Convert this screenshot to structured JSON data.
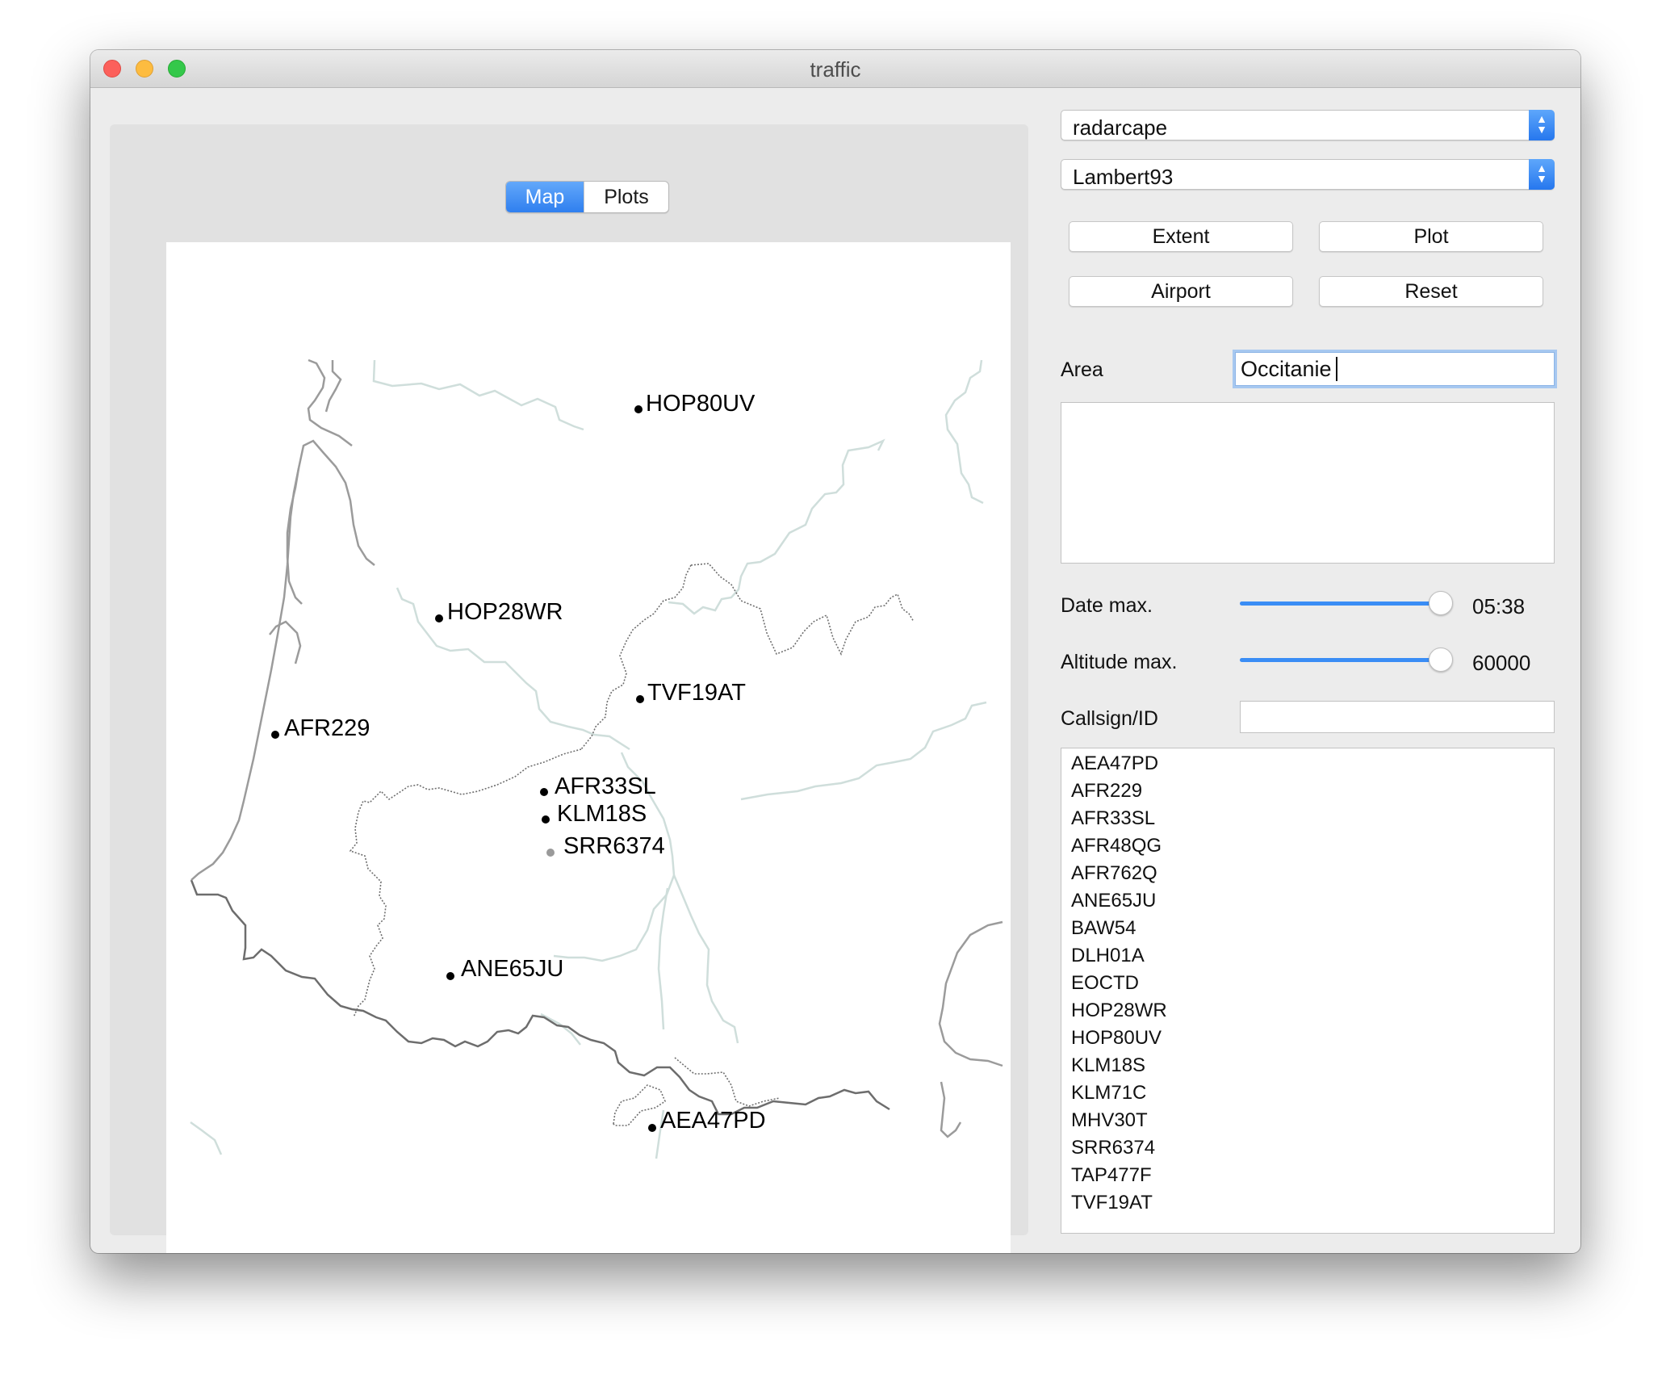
{
  "window": {
    "title": "traffic"
  },
  "tabs": [
    {
      "label": "Map",
      "selected": true
    },
    {
      "label": "Plots",
      "selected": false
    }
  ],
  "source_select": {
    "value": "radarcape"
  },
  "projection_select": {
    "value": "Lambert93"
  },
  "buttons": {
    "extent": "Extent",
    "plot": "Plot",
    "airport": "Airport",
    "reset": "Reset"
  },
  "area": {
    "label": "Area",
    "value": "Occitanie"
  },
  "date_max": {
    "label": "Date max.",
    "value": "05:38",
    "level": 0.96
  },
  "altitude_max": {
    "label": "Altitude max.",
    "value": "60000",
    "level": 0.96
  },
  "callsign": {
    "label": "Callsign/ID",
    "value": ""
  },
  "callsign_list": [
    "AEA47PD",
    "AFR229",
    "AFR33SL",
    "AFR48QG",
    "AFR762Q",
    "ANE65JU",
    "BAW54",
    "DLH01A",
    "EOCTD",
    "HOP28WR",
    "HOP80UV",
    "KLM18S",
    "KLM71C",
    "MHV30T",
    "SRR6374",
    "TAP477F",
    "TVF19AT"
  ],
  "map": {
    "flights": [
      {
        "callsign": "HOP80UV"
      },
      {
        "callsign": "HOP28WR"
      },
      {
        "callsign": "TVF19AT"
      },
      {
        "callsign": "AFR229"
      },
      {
        "callsign": "AFR33SL"
      },
      {
        "callsign": "KLM18S"
      },
      {
        "callsign": "SRR6374"
      },
      {
        "callsign": "ANE65JU"
      },
      {
        "callsign": "AEA47PD"
      }
    ]
  },
  "colors": {
    "accent": "#3a8df5",
    "coastline": "#9b9b9b",
    "border": "#6f6f6f",
    "river": "#cfdedb"
  }
}
